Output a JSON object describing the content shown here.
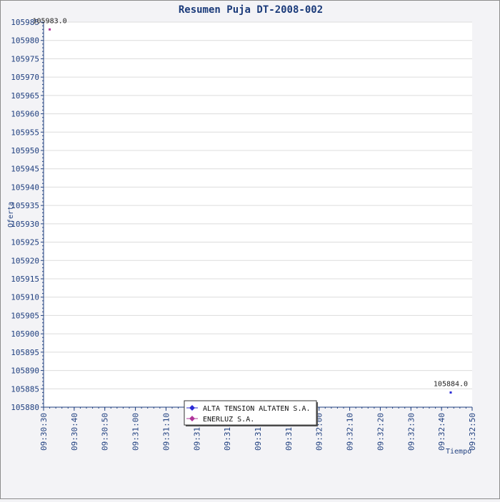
{
  "chart_data": {
    "type": "scatter",
    "title": "Resumen Puja DT-2008-002",
    "xlabel": "Tiempo",
    "ylabel": "Oferta",
    "xlim_seconds": [
      0,
      140
    ],
    "x_ticks": [
      "09:30:30",
      "09:30:40",
      "09:30:50",
      "09:31:00",
      "09:31:10",
      "09:31:20",
      "09:31:30",
      "09:31:40",
      "09:31:50",
      "09:32:00",
      "09:32:10",
      "09:32:20",
      "09:32:30",
      "09:32:40",
      "09:32:50"
    ],
    "ylim": [
      105880,
      105985
    ],
    "y_ticks": [
      105880,
      105885,
      105890,
      105895,
      105900,
      105905,
      105910,
      105915,
      105920,
      105925,
      105930,
      105935,
      105940,
      105945,
      105950,
      105955,
      105960,
      105965,
      105970,
      105975,
      105980,
      105985
    ],
    "grid": true,
    "legend_position": "bottom-center",
    "series": [
      {
        "name": "ALTA TENSION ALTATEN S.A.",
        "color": "#2b2bd6",
        "points": [
          {
            "x": "09:32:43",
            "x_sec": 133,
            "y": 105884.0,
            "label": "105884.0"
          }
        ]
      },
      {
        "name": "ENERLUZ S.A.",
        "color": "#b0349a",
        "points": [
          {
            "x": "09:30:32",
            "x_sec": 2,
            "y": 105983.0,
            "label": "105983.0"
          }
        ]
      }
    ]
  }
}
